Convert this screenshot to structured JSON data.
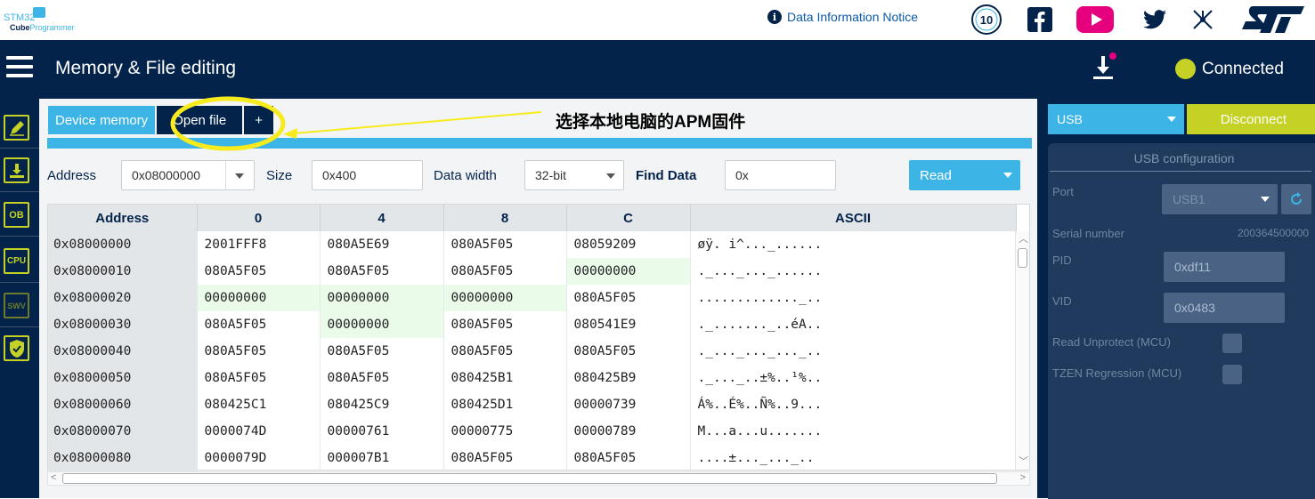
{
  "app": {
    "logo_top": "STM32",
    "logo_bottom_bold": "Cube",
    "logo_bottom": "Programmer"
  },
  "topbar": {
    "notice_label": "Data Information Notice",
    "info_icon": "i",
    "badge_text": "10",
    "icons": [
      "anniversary-badge-icon",
      "facebook-icon",
      "youtube-icon",
      "twitter-icon",
      "network-icon",
      "st-logo-icon"
    ]
  },
  "header": {
    "title": "Memory & File editing",
    "connection_status": "Connected",
    "accent": "#c5d225",
    "navy": "#03234b",
    "blue": "#3cb4e6"
  },
  "sidebar": {
    "items": [
      {
        "name": "edit",
        "label": ""
      },
      {
        "name": "download",
        "label": ""
      },
      {
        "name": "ob",
        "label": "OB"
      },
      {
        "name": "cpu",
        "label": "CPU"
      },
      {
        "name": "swv",
        "label": "SWV"
      },
      {
        "name": "security",
        "label": ""
      }
    ]
  },
  "tabs": [
    {
      "label": "Device memory"
    },
    {
      "label": "Open file"
    },
    {
      "label": "+"
    }
  ],
  "annotation": {
    "text": "选择本地电脑的APM固件"
  },
  "controls": {
    "address_label": "Address",
    "address_value": "0x08000000",
    "size_label": "Size",
    "size_value": "0x400",
    "width_label": "Data width",
    "width_value": "32-bit",
    "find_label": "Find Data",
    "find_value": "0x",
    "read_label": "Read"
  },
  "table": {
    "headers": [
      "Address",
      "0",
      "4",
      "8",
      "C",
      "ASCII"
    ],
    "rows": [
      {
        "addr": "0x08000000",
        "c0": "2001FFF8",
        "c4": "080A5E69",
        "c8": "080A5F05",
        "cc": "08059209",
        "ascii": "øÿ. i^..._......"
      },
      {
        "addr": "0x08000010",
        "c0": "080A5F05",
        "c4": "080A5F05",
        "c8": "080A5F05",
        "cc": "00000000",
        "ascii": "._..._..._......"
      },
      {
        "addr": "0x08000020",
        "c0": "00000000",
        "c4": "00000000",
        "c8": "00000000",
        "cc": "080A5F05",
        "ascii": "............._.."
      },
      {
        "addr": "0x08000030",
        "c0": "080A5F05",
        "c4": "00000000",
        "c8": "080A5F05",
        "cc": "080541E9",
        "ascii": "._......._..éA.."
      },
      {
        "addr": "0x08000040",
        "c0": "080A5F05",
        "c4": "080A5F05",
        "c8": "080A5F05",
        "cc": "080A5F05",
        "ascii": "._..._..._..._.."
      },
      {
        "addr": "0x08000050",
        "c0": "080A5F05",
        "c4": "080A5F05",
        "c8": "080425B1",
        "cc": "080425B9",
        "ascii": "._..._..±%..¹%.."
      },
      {
        "addr": "0x08000060",
        "c0": "080425C1",
        "c4": "080425C9",
        "c8": "080425D1",
        "cc": "00000739",
        "ascii": "Á%..É%..Ñ%..9..."
      },
      {
        "addr": "0x08000070",
        "c0": "0000074D",
        "c4": "00000761",
        "c8": "00000775",
        "cc": "00000789",
        "ascii": "M...a...u......."
      },
      {
        "addr": "0x08000080",
        "c0": "0000079D",
        "c4": "000007B1",
        "c8": "080A5F05",
        "cc": "080A5F05",
        "ascii": "....±..._..._.."
      }
    ]
  },
  "right_panel": {
    "interface": "USB",
    "disconnect_label": "Disconnect",
    "config_title": "USB configuration",
    "port_label": "Port",
    "port_value": "USB1",
    "serial_label": "Serial number",
    "serial_value": "200364500000",
    "pid_label": "PID",
    "pid_value": "0xdf11",
    "vid_label": "VID",
    "vid_value": "0x0483",
    "read_unprotect_label": "Read Unprotect (MCU)",
    "tzen_label": "TZEN Regression (MCU)"
  }
}
